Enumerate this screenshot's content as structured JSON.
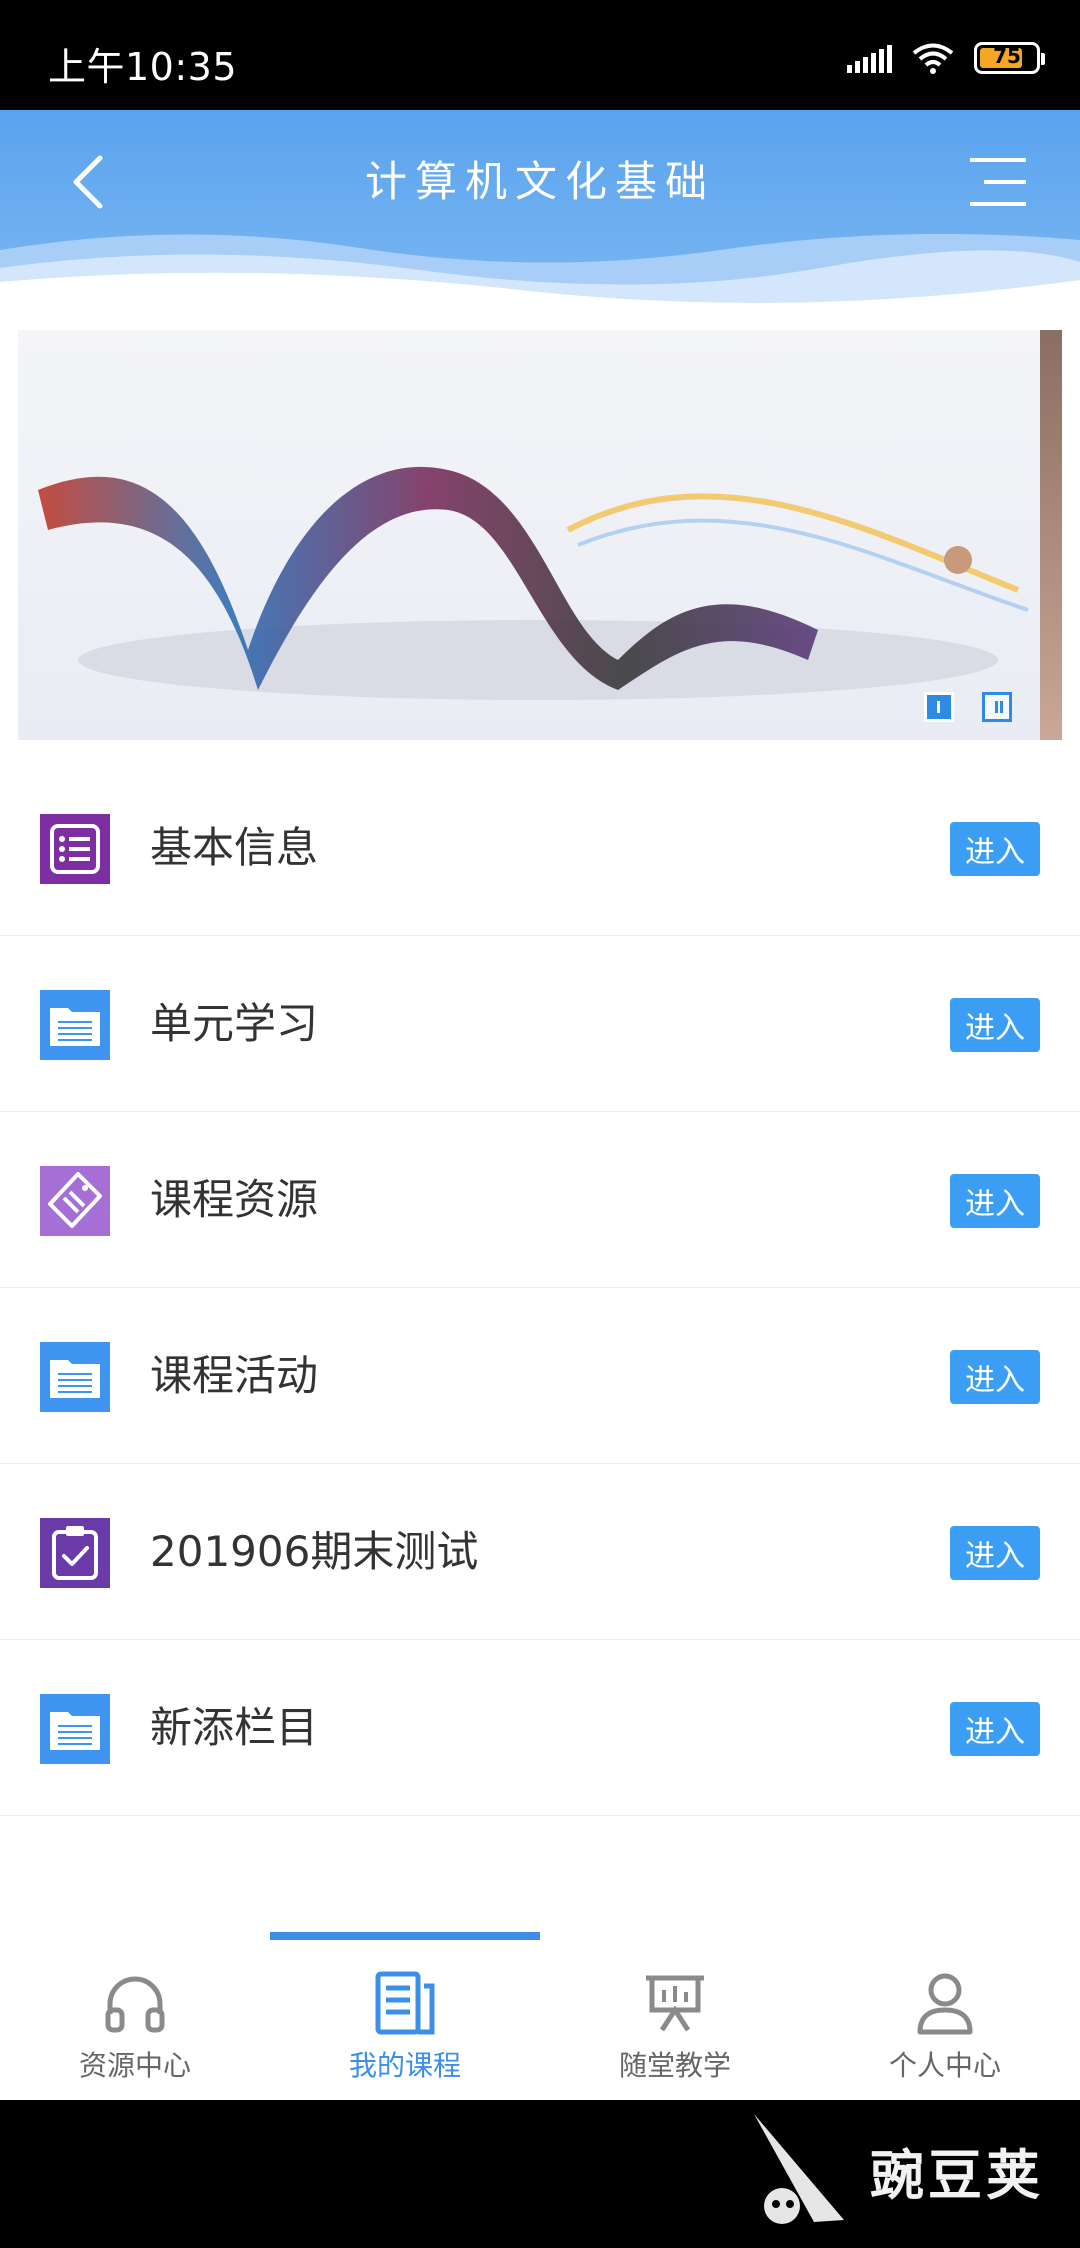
{
  "status_bar": {
    "time": "上午10:35",
    "battery": "75"
  },
  "header": {
    "title": "计算机文化基础"
  },
  "banner": {
    "pages": 2,
    "active_page": 1
  },
  "menu": {
    "enter_label": "进入",
    "items": [
      {
        "label": "基本信息",
        "icon": "list-icon",
        "color": "#7d2ea0"
      },
      {
        "label": "单元学习",
        "icon": "folder-doc-icon",
        "color": "#3f94f0"
      },
      {
        "label": "课程资源",
        "icon": "tag-icon",
        "color": "#a56fd6"
      },
      {
        "label": "课程活动",
        "icon": "folder-doc-icon",
        "color": "#3f94f0"
      },
      {
        "label": "201906期末测试",
        "icon": "clipboard-check-icon",
        "color": "#6a3aa8"
      },
      {
        "label": "新添栏目",
        "icon": "folder-doc-icon",
        "color": "#3f94f0"
      }
    ]
  },
  "bottom_nav": {
    "items": [
      {
        "label": "资源中心",
        "icon": "headphones-icon",
        "active": false
      },
      {
        "label": "我的课程",
        "icon": "document-icon",
        "active": true
      },
      {
        "label": "随堂教学",
        "icon": "presentation-icon",
        "active": false
      },
      {
        "label": "个人中心",
        "icon": "user-icon",
        "active": false
      }
    ]
  },
  "watermark": {
    "text": "豌豆荚"
  }
}
